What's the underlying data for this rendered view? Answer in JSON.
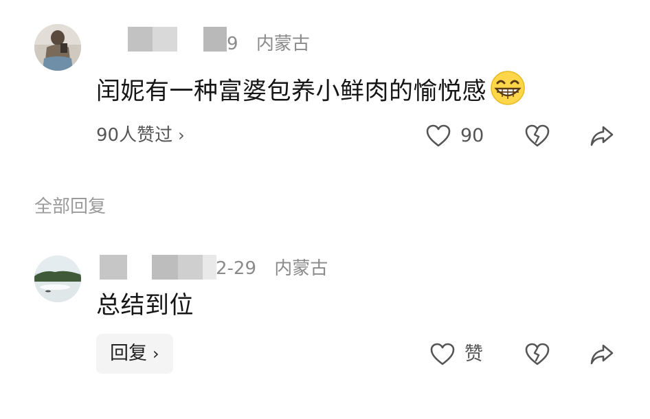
{
  "comment": {
    "meta_suffix": "9",
    "location": "内蒙古",
    "text": "闰妮有一种富婆包养小鲜肉的愉悦感",
    "emoji": "grinning-face-emoji",
    "likes_link": "90人赞过",
    "like_count": "90"
  },
  "section": {
    "label": "全部回复"
  },
  "reply": {
    "meta_date": "2-29",
    "location": "内蒙古",
    "text": "总结到位",
    "reply_button": "回复",
    "like_label": "赞"
  },
  "colors": {
    "meta_gray": "#8a8a8a",
    "icon_gray": "#555555",
    "reply_bg": "#f4f4f4"
  }
}
